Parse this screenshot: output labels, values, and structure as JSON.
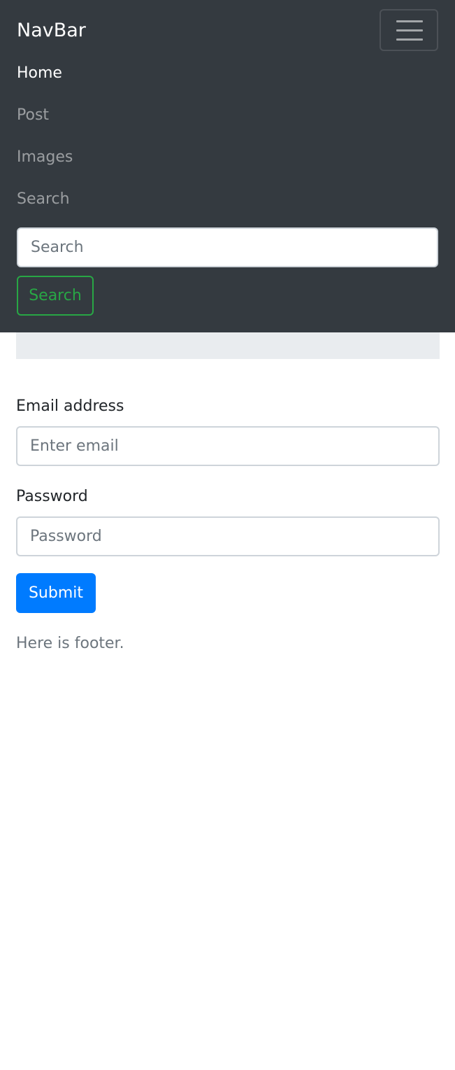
{
  "navbar": {
    "brand": "NavBar",
    "toggler_icon": "hamburger-menu-icon",
    "links": [
      {
        "label": "Home",
        "active": true
      },
      {
        "label": "Post",
        "active": false
      },
      {
        "label": "Images",
        "active": false
      },
      {
        "label": "Search",
        "active": false
      }
    ],
    "search": {
      "placeholder": "Search",
      "button_label": "Search"
    }
  },
  "form": {
    "email_label": "Email address",
    "email_placeholder": "Enter email",
    "password_label": "Password",
    "password_placeholder": "Password",
    "submit_label": "Submit"
  },
  "footer": {
    "text": "Here is footer."
  },
  "colors": {
    "navbar_bg": "#343a40",
    "primary": "#007bff",
    "success": "#28a745",
    "jumbotron_bg": "#e9ecef",
    "muted_text": "#6c757d"
  }
}
